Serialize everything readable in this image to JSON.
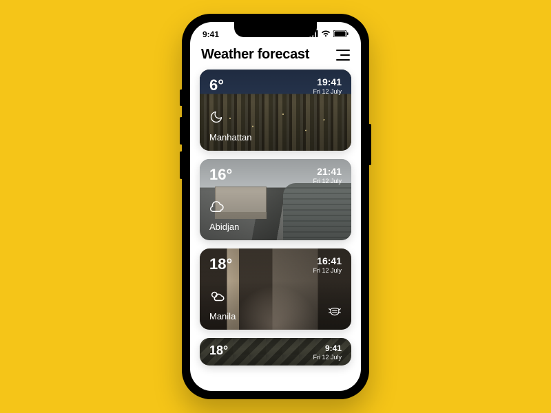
{
  "status": {
    "time": "9:41"
  },
  "header": {
    "title": "Weather forecast"
  },
  "cards": [
    {
      "temp": "6°",
      "time": "19:41",
      "date": "Fri 12 July",
      "city": "Manhattan",
      "icon": "moon"
    },
    {
      "temp": "16°",
      "time": "21:41",
      "date": "Fri 12 July",
      "city": "Abidjan",
      "icon": "cloud"
    },
    {
      "temp": "18°",
      "time": "16:41",
      "date": "Fri 12 July",
      "city": "Manila",
      "icon": "partly-cloudy",
      "icon_right": "mask"
    },
    {
      "temp": "18°",
      "time": "9:41",
      "date": "Fri 12 July",
      "city": "",
      "icon": ""
    }
  ]
}
